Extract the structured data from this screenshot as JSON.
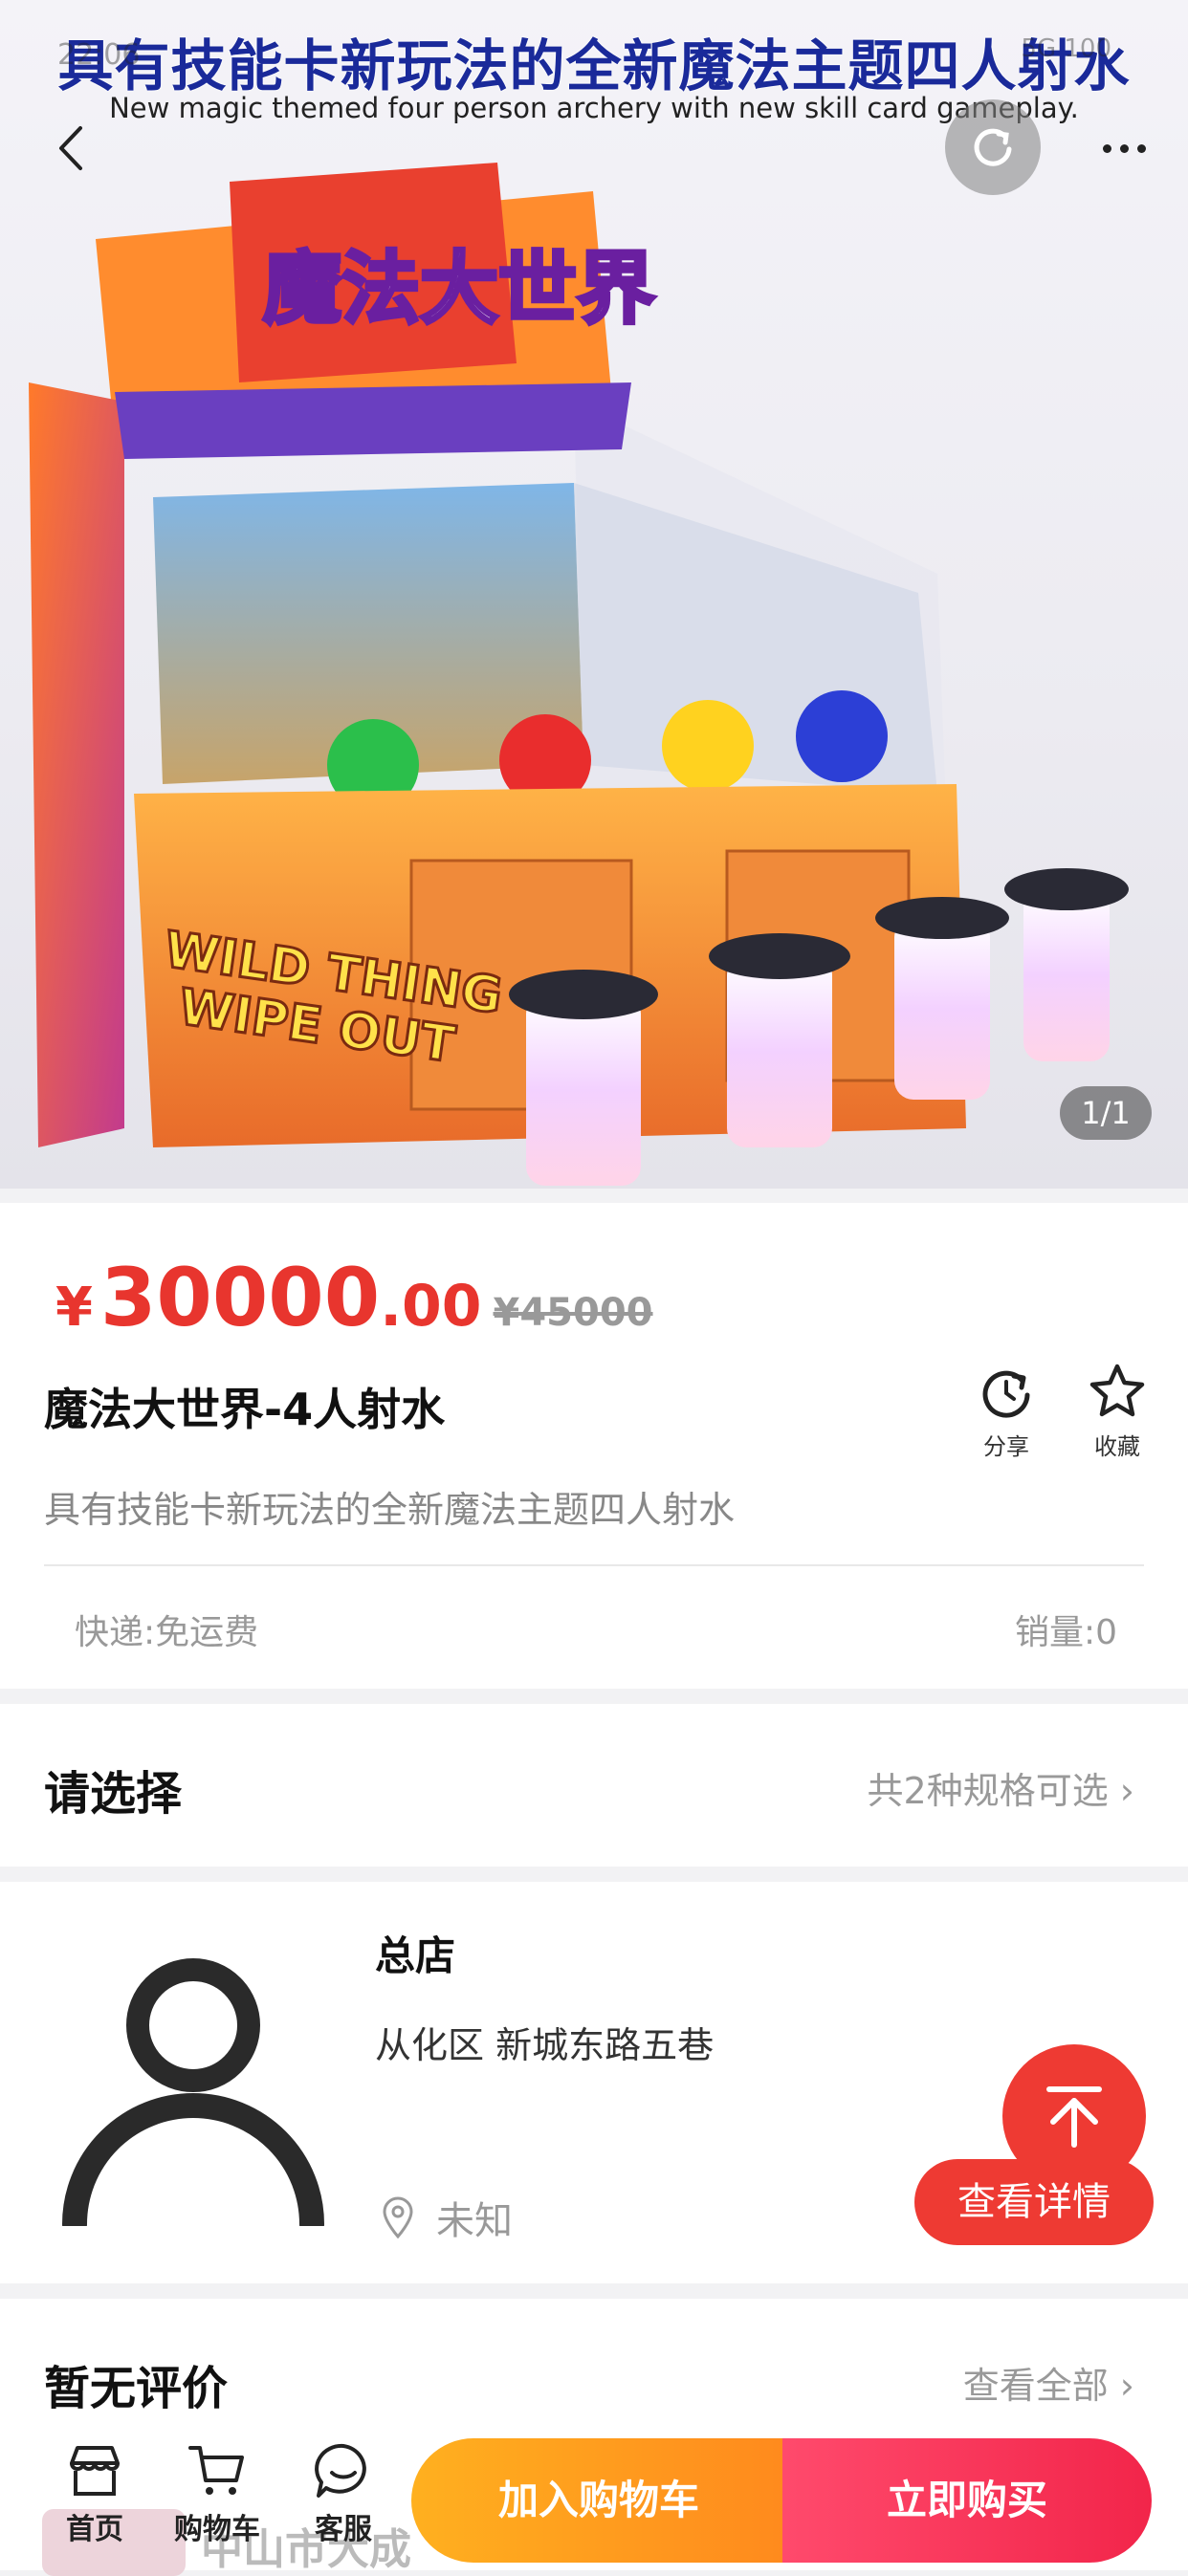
{
  "status_bar": {
    "time": "22:06",
    "right": "5G 100"
  },
  "hero": {
    "banner_title": "具有技能卡新玩法的全新魔法主题四人射水",
    "banner_subtitle": "New magic themed four person archery with new skill card gameplay.",
    "cabinet_title": "魔法大世界",
    "cabinet_slogan_1": "WILD THING",
    "cabinet_slogan_2": "WIPE OUT",
    "image_counter": "1/1"
  },
  "product": {
    "price_symbol": "¥",
    "price_integer": "30000",
    "price_decimal": ".00",
    "original_price": "¥45000",
    "title": "魔法大世界-4人射水",
    "description": "具有技能卡新玩法的全新魔法主题四人射水",
    "share_label": "分享",
    "favorite_label": "收藏",
    "shipping": "快递:免运费",
    "sales": "销量:0"
  },
  "select": {
    "title": "请选择",
    "hint": "共2种规格可选"
  },
  "store": {
    "name": "总店",
    "address": "从化区 新城东路五巷",
    "location": "未知",
    "detail_button": "查看详情"
  },
  "reviews": {
    "title": "暂无评价",
    "view_all": "查看全部",
    "footer_text": "中山市大成"
  },
  "bottom_bar": {
    "home": "首页",
    "cart": "购物车",
    "service": "客服",
    "add_to_cart": "加入购物车",
    "buy_now": "立即购买"
  },
  "colors": {
    "accent": "#e8352e",
    "cart_orange": "#ff9a1d",
    "buy_red": "#f2254a"
  }
}
